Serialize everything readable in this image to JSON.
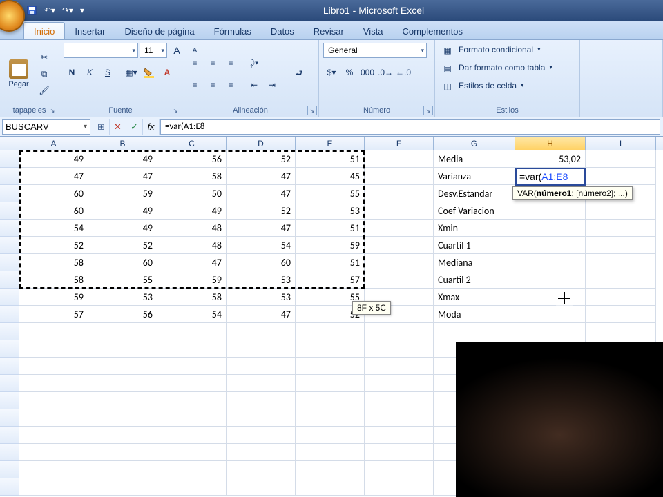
{
  "title": "Libro1 - Microsoft Excel",
  "tabs": [
    "Inicio",
    "Insertar",
    "Diseño de página",
    "Fórmulas",
    "Datos",
    "Revisar",
    "Vista",
    "Complementos"
  ],
  "active_tab": 0,
  "ribbon": {
    "clipboard": {
      "label": "tapapeles",
      "paste": "Pegar"
    },
    "font": {
      "label": "Fuente",
      "name": "",
      "size": "11"
    },
    "align": {
      "label": "Alineación"
    },
    "number": {
      "label": "Número",
      "format": "General"
    },
    "styles": {
      "label": "Estilos",
      "cond": "Formato condicional",
      "table": "Dar formato como tabla",
      "cell": "Estilos de celda"
    }
  },
  "namebox": "BUSCARV",
  "formula": "=var(A1:E8",
  "edit_display_prefix": "=var(",
  "edit_display_ref": "A1:E8",
  "syntax_hint_html": "VAR(<b>número1</b>; [número2]; ...)",
  "sel_hint": "8F x 5C",
  "columns": [
    "A",
    "B",
    "C",
    "D",
    "E",
    "F",
    "G",
    "H",
    "I"
  ],
  "active_col": "H",
  "stats_labels": [
    "Media",
    "Varianza",
    "Desv.Estandar",
    "Coef Variacion",
    "Xmin",
    "Cuartil 1",
    "Mediana",
    "Cuartil 2",
    "Xmax",
    "Moda"
  ],
  "stats_values": {
    "Media": "53,02"
  },
  "data": [
    [
      49,
      49,
      56,
      52,
      51
    ],
    [
      47,
      47,
      58,
      47,
      45
    ],
    [
      60,
      59,
      50,
      47,
      55
    ],
    [
      60,
      49,
      49,
      52,
      53
    ],
    [
      54,
      49,
      48,
      47,
      51
    ],
    [
      52,
      52,
      48,
      54,
      59
    ],
    [
      58,
      60,
      47,
      60,
      51
    ],
    [
      58,
      55,
      59,
      53,
      57
    ],
    [
      59,
      53,
      58,
      53,
      55
    ],
    [
      57,
      56,
      54,
      47,
      52
    ]
  ]
}
